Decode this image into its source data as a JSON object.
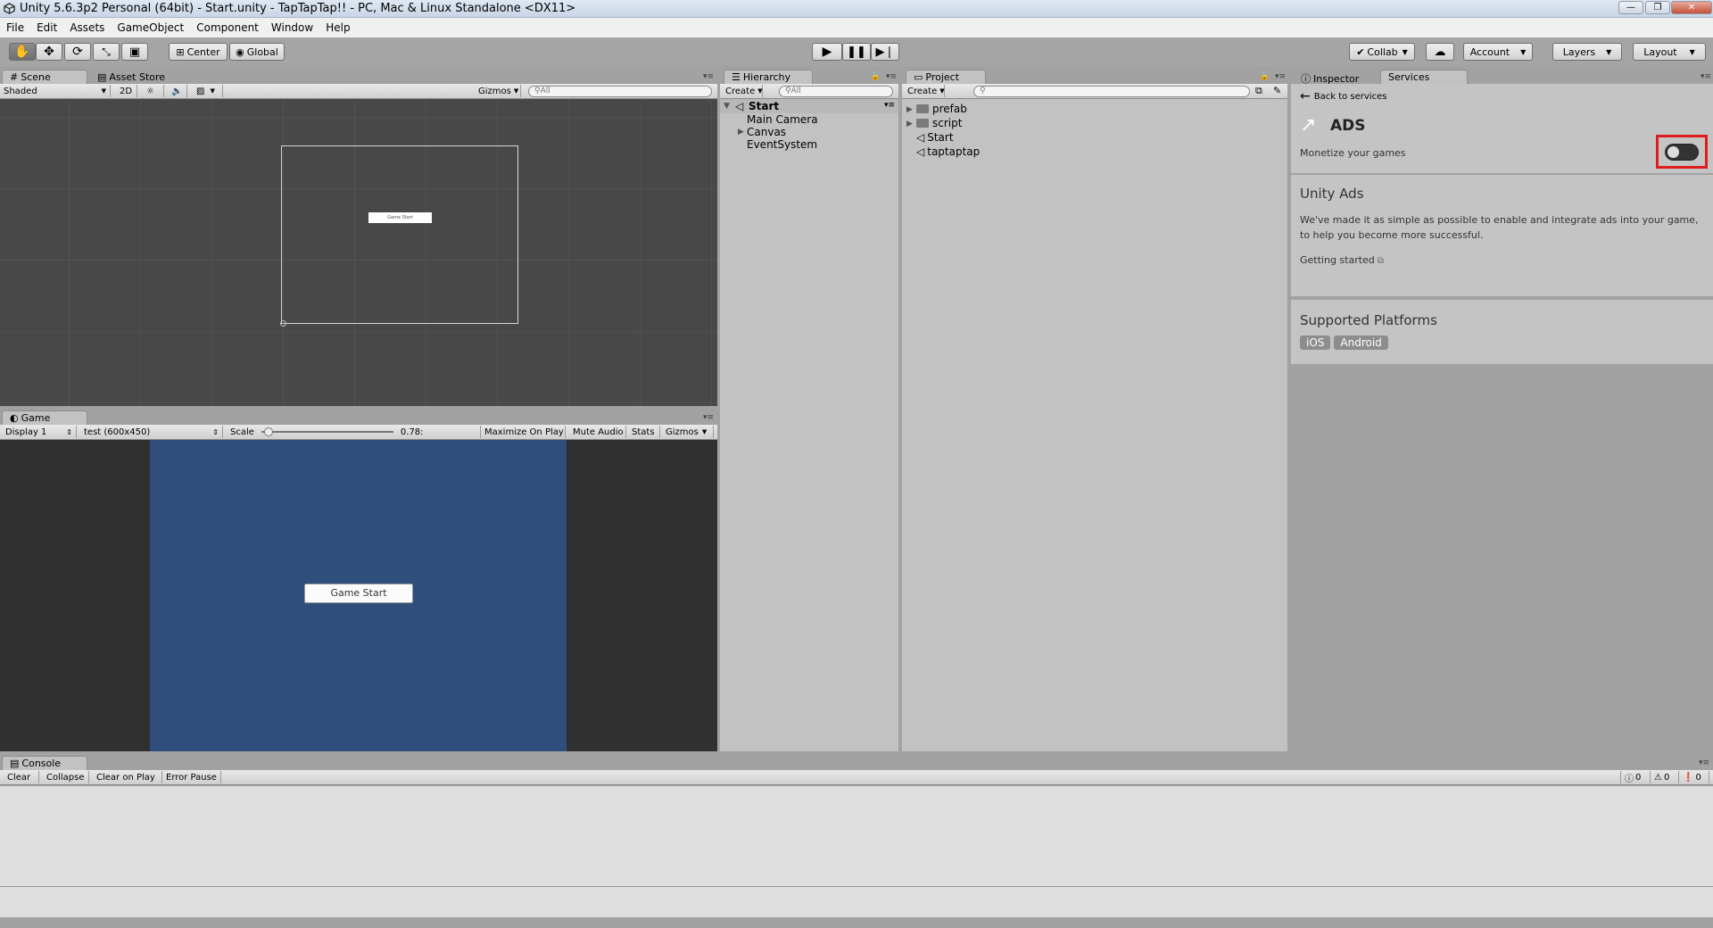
{
  "window": {
    "title": "Unity 5.6.3p2 Personal (64bit) - Start.unity - TapTapTap!! - PC, Mac & Linux Standalone <DX11>",
    "minimize": "—",
    "maximize": "❐",
    "close": "✕"
  },
  "menu": [
    "File",
    "Edit",
    "Assets",
    "GameObject",
    "Component",
    "Window",
    "Help"
  ],
  "toolbar": {
    "pivot_label": "Center",
    "space_label": "Global",
    "collab_label": "Collab",
    "account_label": "Account",
    "layers_label": "Layers",
    "layout_label": "Layout"
  },
  "scene": {
    "tab_label": "Scene",
    "asset_store_tab": "Asset Store",
    "shading_mode": "Shaded",
    "mode_2d": "2D",
    "gizmos_label": "Gizmos",
    "search_placeholder": "All",
    "button_label": "Game Start"
  },
  "game": {
    "tab_label": "Game",
    "display": "Display 1",
    "resolution": "test (600x450)",
    "scale_label": "Scale",
    "scale_value": "0.78:",
    "scale_fraction": 0.02,
    "maximize_on_play": "Maximize On Play",
    "mute_audio": "Mute Audio",
    "stats": "Stats",
    "gizmos": "Gizmos",
    "button_label": "Game Start"
  },
  "hierarchy": {
    "tab_label": "Hierarchy",
    "create_label": "Create",
    "search_placeholder": "All",
    "scene_name": "Start",
    "items": [
      "Main Camera",
      "Canvas",
      "EventSystem"
    ]
  },
  "project": {
    "tab_label": "Project",
    "create_label": "Create",
    "items": [
      "prefab",
      "script",
      "Start",
      "taptaptap"
    ]
  },
  "inspector": {
    "inspector_tab": "Inspector",
    "services_tab": "Services",
    "back_link": "Back to services",
    "service_title": "ADS",
    "service_subtitle": "Monetize your games",
    "toggle_on": false,
    "section_title": "Unity Ads",
    "description": "We've made it as simple as possible to enable and integrate ads into your game, to help you become more successful.",
    "getting_started": "Getting started",
    "platforms_title": "Supported Platforms",
    "platforms": [
      "iOS",
      "Android"
    ],
    "highlight_color": "#e01b1b"
  },
  "console": {
    "tab_label": "Console",
    "clear": "Clear",
    "collapse": "Collapse",
    "clear_on_play": "Clear on Play",
    "error_pause": "Error Pause",
    "info_count": "0",
    "warning_count": "0",
    "error_count": "0"
  }
}
